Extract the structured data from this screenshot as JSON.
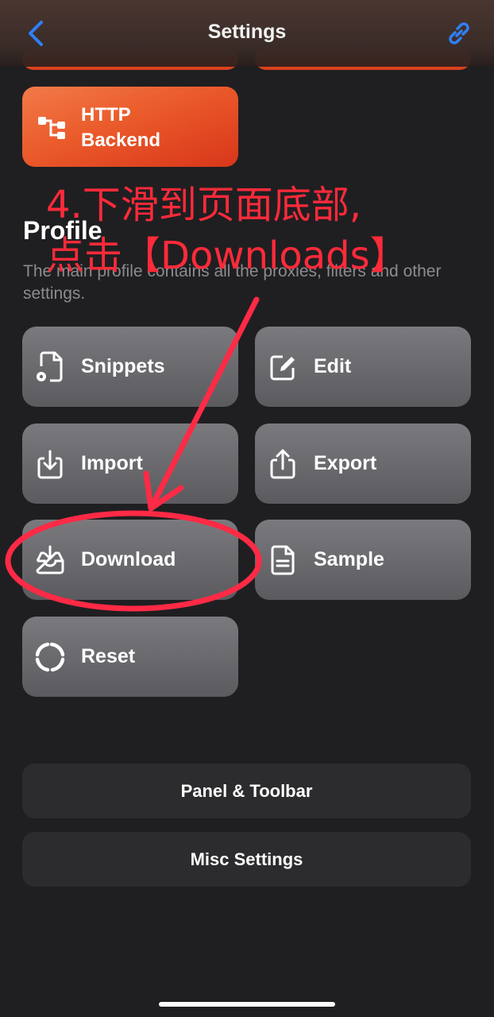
{
  "navbar": {
    "title": "Settings",
    "back_icon": "chevron-left-icon",
    "link_icon": "link-icon",
    "accent": "#2f7ff7"
  },
  "top_buttons": {
    "http_backend_label": "HTTP\nBackend",
    "http_backend_icon": "network-tree-icon"
  },
  "profile": {
    "title": "Profile",
    "description": "The main profile contains all the proxies, filters and other settings.",
    "buttons": [
      {
        "label": "Snippets",
        "icon": "document-gear-icon"
      },
      {
        "label": "Edit",
        "icon": "edit-square-icon"
      },
      {
        "label": "Import",
        "icon": "import-tray-icon"
      },
      {
        "label": "Export",
        "icon": "share-export-icon"
      },
      {
        "label": "Download",
        "icon": "download-tray-icon"
      },
      {
        "label": "Sample",
        "icon": "document-text-icon"
      },
      {
        "label": "Reset",
        "icon": "reset-circle-icon"
      }
    ]
  },
  "settings_links": {
    "panel_toolbar": "Panel & Toolbar",
    "misc_settings": "Misc Settings"
  },
  "annotation": {
    "text": "4.下滑到页面底部,\n点击【Downloads】",
    "color": "#ff2a3a"
  }
}
